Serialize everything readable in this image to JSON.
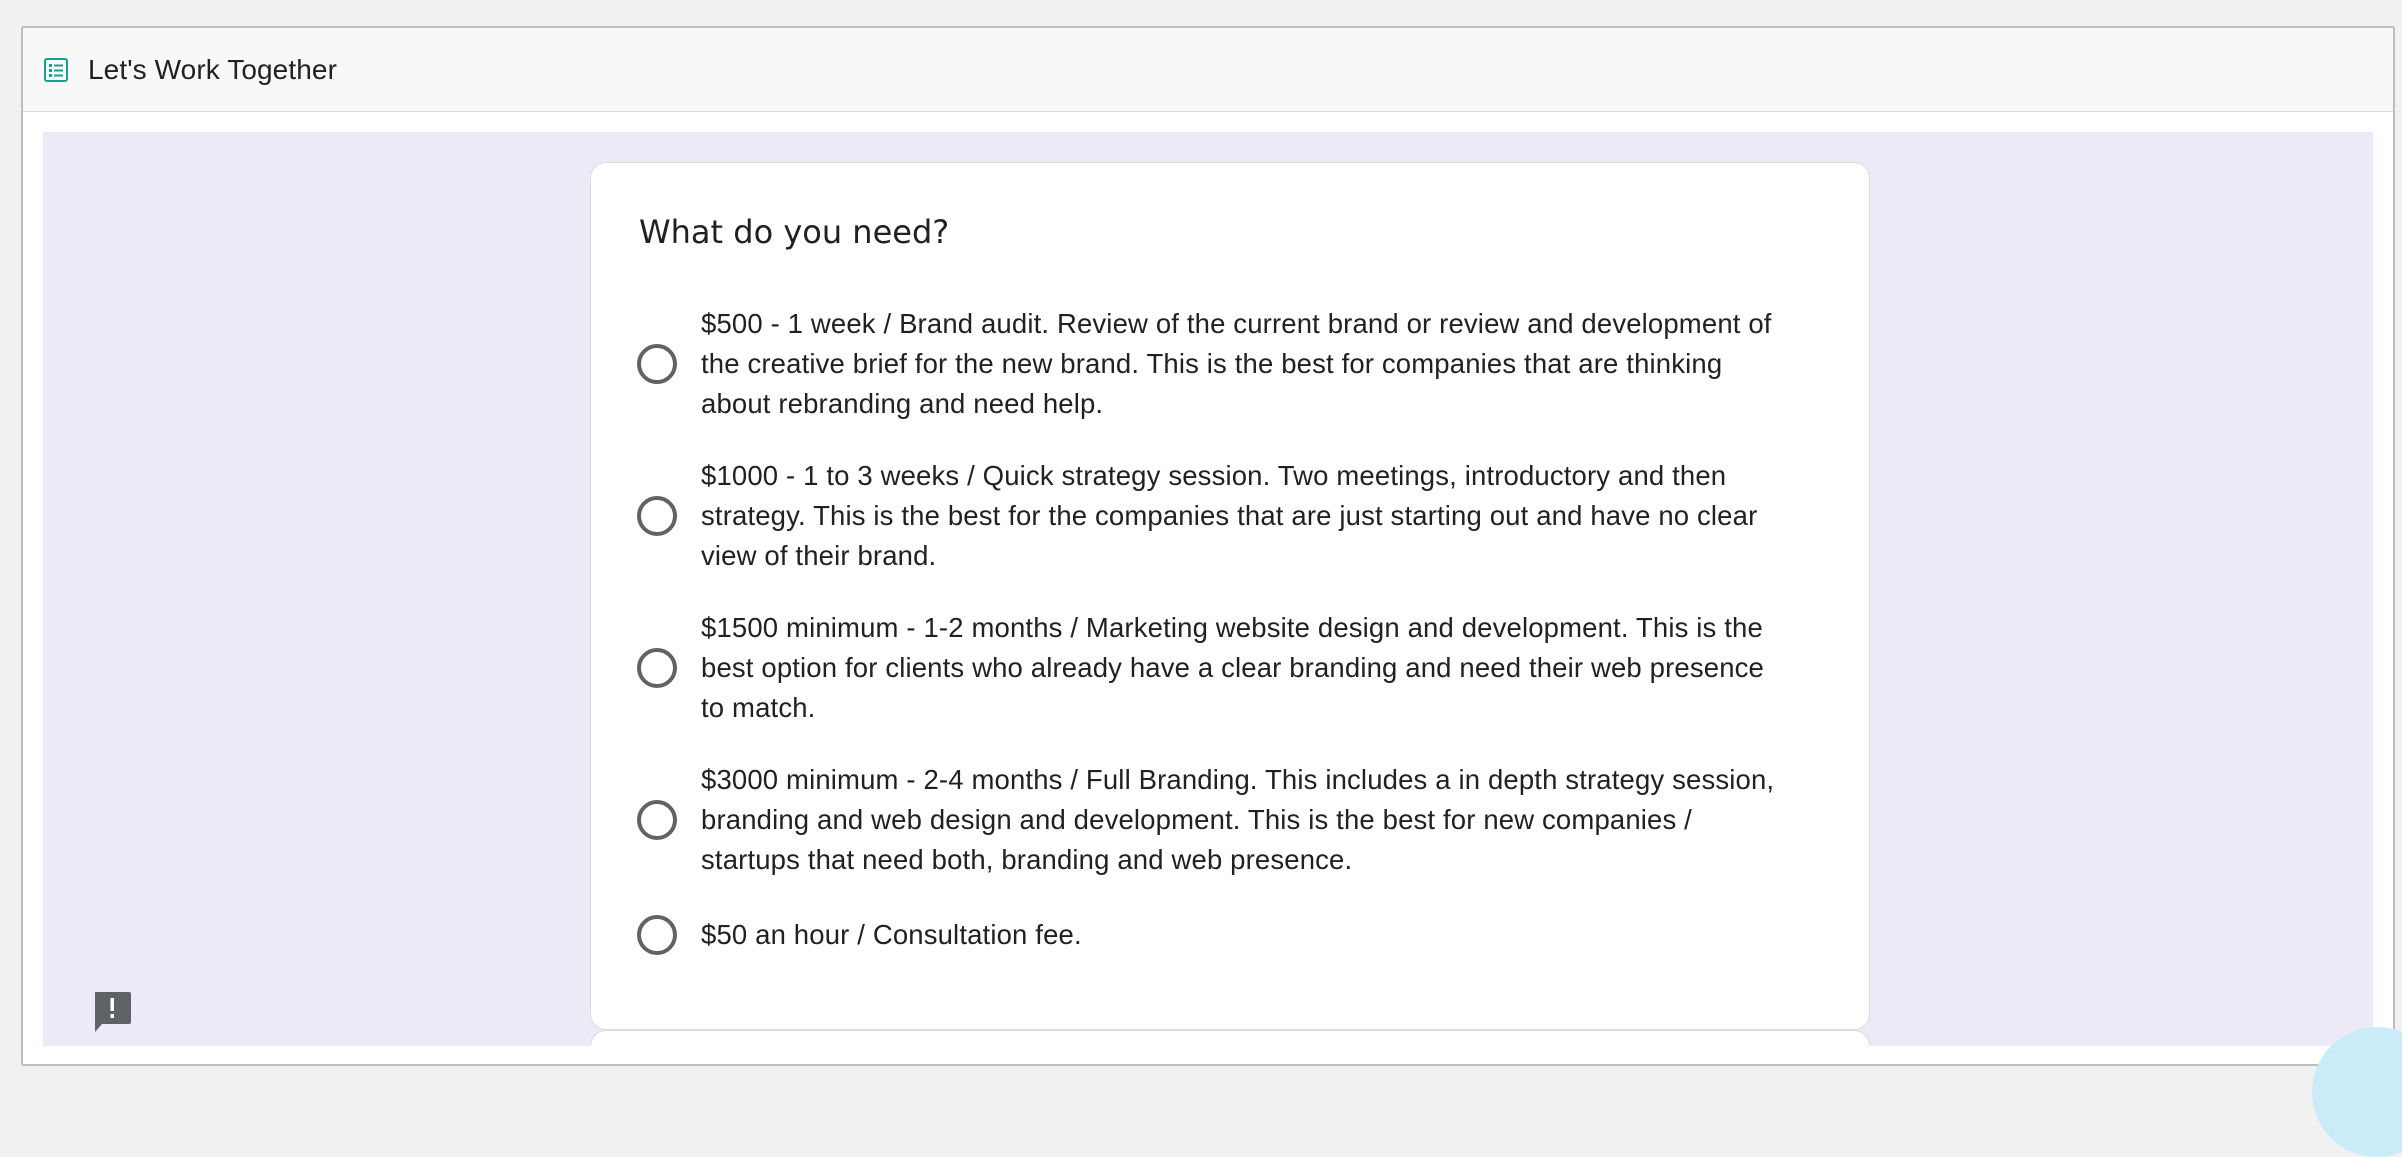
{
  "window": {
    "title": "Let's Work Together",
    "title_icon": "form-icon"
  },
  "form": {
    "question": "What do you need?",
    "options": [
      {
        "label": "$500 - 1 week / Brand audit. Review of the current brand or review and development of the creative brief for the new brand. This is the best for companies that are thinking about rebranding and need help.",
        "selected": false
      },
      {
        "label": "$1000 - 1 to 3 weeks / Quick strategy session. Two meetings, introductory and then strategy. This is the best for the companies that are just starting out and have no clear view of their brand.",
        "selected": false
      },
      {
        "label": "$1500 minimum - 1-2 months / Marketing website design and development. This is the best option for clients who already have a clear branding and need their web presence to match.",
        "selected": false
      },
      {
        "label": "$3000 minimum - 2-4 months / Full Branding. This includes a in depth strategy session, branding and web design and development. This is the best for new companies / startups that need both, branding and web presence.",
        "selected": false
      },
      {
        "label": "$50 an hour / Consultation fee.",
        "selected": false
      }
    ]
  },
  "icons": {
    "feedback": "report-feedback-icon"
  },
  "colors": {
    "background": "#ede9f7",
    "card": "#ffffff",
    "radio_border": "#5f6368",
    "form_icon": "#00897b"
  }
}
